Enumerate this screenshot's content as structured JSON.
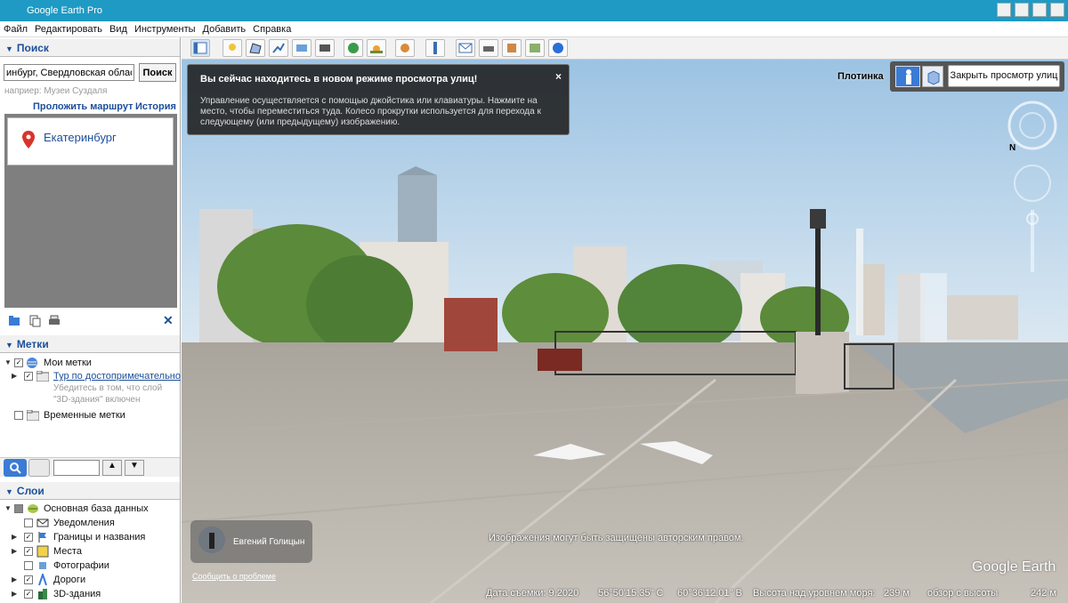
{
  "app": {
    "title": "Google Earth Pro"
  },
  "menu": [
    "Файл",
    "Редактировать",
    "Вид",
    "Инструменты",
    "Добавить",
    "Справка"
  ],
  "search": {
    "header": "Поиск",
    "value": "инбург, Свердловская область",
    "button": "Поиск",
    "hint": "наприер: Музеи Суздаля",
    "route_link": "Проложить маршрут",
    "history_link": "История",
    "result": "Екатеринбург"
  },
  "places": {
    "header": "Метки",
    "items": [
      {
        "label": "Мои метки",
        "checked": true
      },
      {
        "label": "Тур по достопримечательно",
        "checked": true,
        "link": true
      },
      {
        "label": "Убедитесь в том, что слой",
        "note": true
      },
      {
        "label": "\"3D-здания\" включен",
        "note": true
      },
      {
        "label": "Временные метки",
        "checked": false
      }
    ]
  },
  "layers": {
    "header": "Слои",
    "items": [
      {
        "label": "Основная база данных",
        "checked": true
      },
      {
        "label": "Уведомления",
        "checked": false
      },
      {
        "label": "Границы и названия",
        "checked": true
      },
      {
        "label": "Места",
        "checked": true
      },
      {
        "label": "Фотографии",
        "checked": false
      },
      {
        "label": "Дороги",
        "checked": true
      },
      {
        "label": "3D-здания",
        "checked": true
      }
    ]
  },
  "streetview": {
    "notice_title": "Вы сейчас находитесь в новом режиме просмотра улиц!",
    "notice_body": "Управление осуществляется с помощью джойстика или клавиатуры. Нажмите на место, чтобы переместиться туда. Колесо прокрутки используется для перехода к следующему (или предыдущему) изображению.",
    "notice_close": "×",
    "place_label": "Плотинка",
    "close_button": "Закрыть просмотр улиц",
    "author": "Евгений Голицын",
    "report": "Сообщить о проблеме",
    "copyright": "Изображения могут быть защищены авторским правом.",
    "brand": "Google Earth"
  },
  "status": {
    "date": "Дата съемки: 9.2020",
    "lat": "56°50'15.35\" С",
    "lon": "60°36'12.01\" В",
    "elev_label": "Высота над уровнем моря:",
    "elev_value": "239 м",
    "eye_label": "обзор с высоты",
    "eye_value": "242 м"
  },
  "colors": {
    "title_bar": "#1e9ac4",
    "link": "#1c4f9a",
    "sky": "#b7d3ea",
    "plaza": "#b9b4ac"
  }
}
